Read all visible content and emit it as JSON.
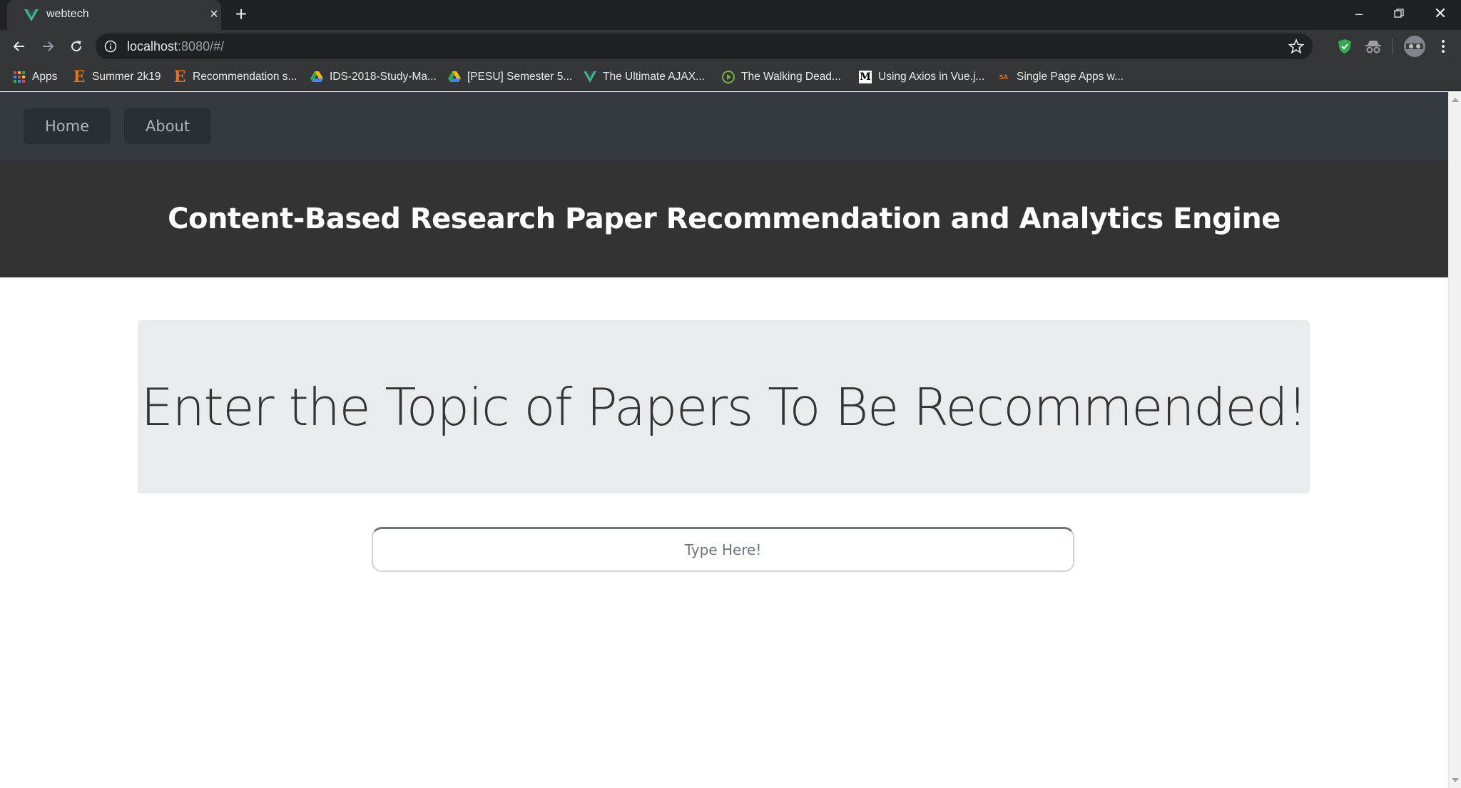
{
  "browser": {
    "tab_title": "webtech",
    "url_host": "localhost",
    "url_rest": ":8080/#/",
    "bookmarks": [
      {
        "label": "Apps",
        "icon": "apps-grid-icon"
      },
      {
        "label": "Summer 2k19",
        "icon": "e-icon"
      },
      {
        "label": "Recommendation s...",
        "icon": "e-icon"
      },
      {
        "label": "IDS-2018-Study-Ma...",
        "icon": "google-drive-icon"
      },
      {
        "label": "[PESU] Semester 5...",
        "icon": "google-drive-icon"
      },
      {
        "label": "The Ultimate AJAX...",
        "icon": "vue-icon"
      },
      {
        "label": "The Walking Dead...",
        "icon": "play-icon"
      },
      {
        "label": "Using Axios in Vue.j...",
        "icon": "medium-icon"
      },
      {
        "label": "Single Page Apps w...",
        "icon": "sa-icon"
      }
    ]
  },
  "nav": {
    "home": "Home",
    "about": "About"
  },
  "hero": {
    "title": "Content-Based Research Paper Recommendation and Analytics Engine"
  },
  "jumbotron": {
    "heading": "Enter the Topic of Papers To Be Recommended!"
  },
  "search": {
    "value": "",
    "placeholder": "Type Here!"
  },
  "colors": {
    "nav_bg": "#343a40",
    "hero_bg": "#333333",
    "jumbotron_bg": "#e9ecef",
    "chrome_dark": "#202124",
    "chrome_mid": "#35363a"
  }
}
